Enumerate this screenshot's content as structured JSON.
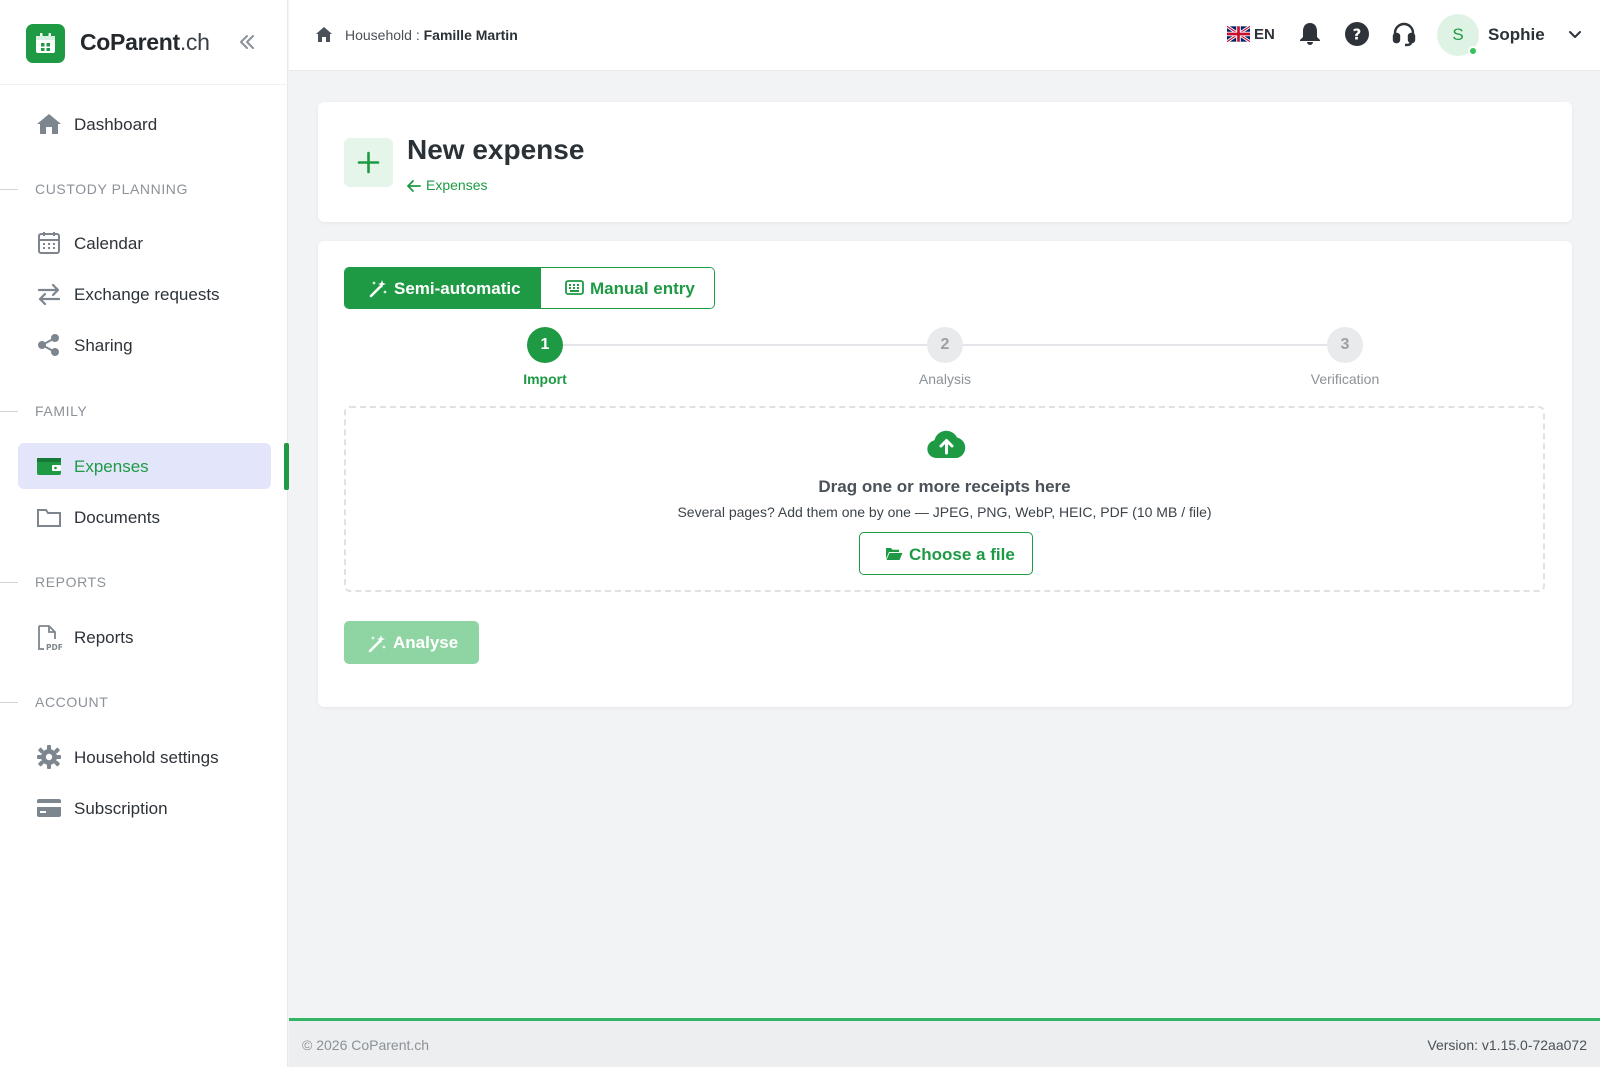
{
  "brand": {
    "name": "CoParent",
    "suffix": ".ch"
  },
  "sidebar": {
    "items": [
      {
        "label": "Dashboard",
        "icon": "home-icon"
      },
      {
        "label": "Calendar",
        "icon": "calendar-icon"
      },
      {
        "label": "Exchange requests",
        "icon": "swap-icon"
      },
      {
        "label": "Sharing",
        "icon": "share-icon"
      },
      {
        "label": "Expenses",
        "icon": "wallet-icon",
        "active": true
      },
      {
        "label": "Documents",
        "icon": "folder-icon"
      },
      {
        "label": "Reports",
        "icon": "pdf-icon"
      },
      {
        "label": "Household settings",
        "icon": "gear-icon"
      },
      {
        "label": "Subscription",
        "icon": "credit-card-icon"
      }
    ],
    "sections": [
      "CUSTODY PLANNING",
      "FAMILY",
      "REPORTS",
      "ACCOUNT"
    ]
  },
  "topbar": {
    "breadcrumb_prefix": "Household : ",
    "household": "Famille Martin",
    "language": "EN",
    "user_initial": "S",
    "user_name": "Sophie"
  },
  "header": {
    "title": "New expense",
    "back_link": "Expenses"
  },
  "mode": {
    "semi_auto": "Semi-automatic",
    "manual": "Manual entry",
    "selected": "Semi-automatic"
  },
  "steps": [
    {
      "num": "1",
      "label": "Import",
      "state": "current"
    },
    {
      "num": "2",
      "label": "Analysis",
      "state": "todo"
    },
    {
      "num": "3",
      "label": "Verification",
      "state": "todo"
    }
  ],
  "dropzone": {
    "title": "Drag one or more receipts here",
    "subtitle": "Several pages? Add them one by one — JPEG, PNG, WebP, HEIC, PDF (10 MB / file)",
    "choose_label": "Choose a file"
  },
  "analyse_label": "Analyse",
  "footer": {
    "copyright": "© 2026 CoParent.ch",
    "version": "Version: v1.15.0-72aa072"
  },
  "colors": {
    "accent": "#1e9a44",
    "active_bg": "#e3e6fb",
    "disabled": "#8fd4a3"
  }
}
